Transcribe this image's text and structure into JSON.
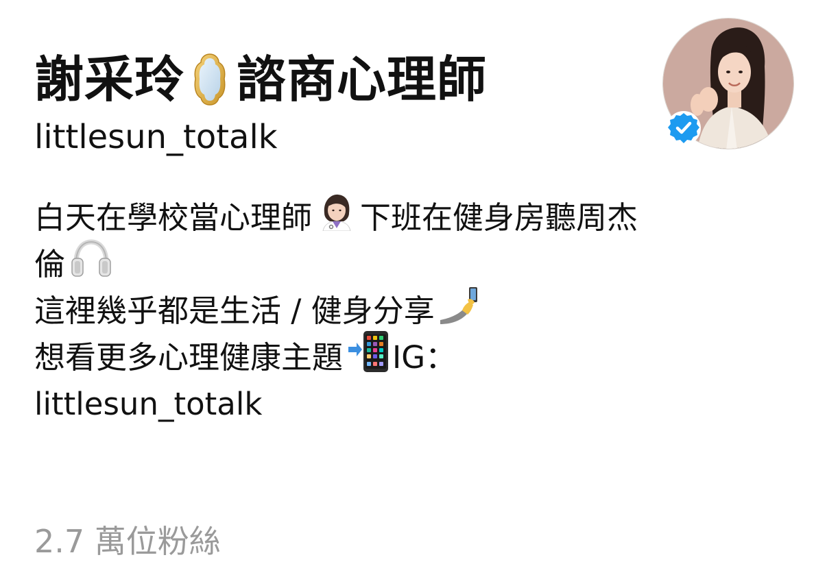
{
  "profile": {
    "name_part1": "謝采玲",
    "name_icon": "mirror-icon",
    "name_part2": "諮商心理師",
    "username": "littlesun_totalk",
    "verified_icon": "verified-badge-icon",
    "bio": {
      "line1_a": "白天在學校當心理師",
      "line1_icon": "woman-health-worker-emoji",
      "line1_b": "下班在健身房聽周杰",
      "line2_a": "倫",
      "line2_icon": "headphones-emoji",
      "line3_a": "這裡幾乎都是生活 / 健身分享",
      "line3_icon": "selfie-emoji",
      "line4_a": "想看更多心理健康主題",
      "line4_icon": "mobile-arrow-emoji",
      "line4_b": "IG：",
      "line5_a": "littlesun_totalk"
    },
    "followers": "2.7 萬位粉絲"
  },
  "colors": {
    "text": "#111111",
    "muted": "#9a9a9a",
    "verified_blue": "#1d9bf0",
    "avatar_bg": "#cba99f"
  }
}
